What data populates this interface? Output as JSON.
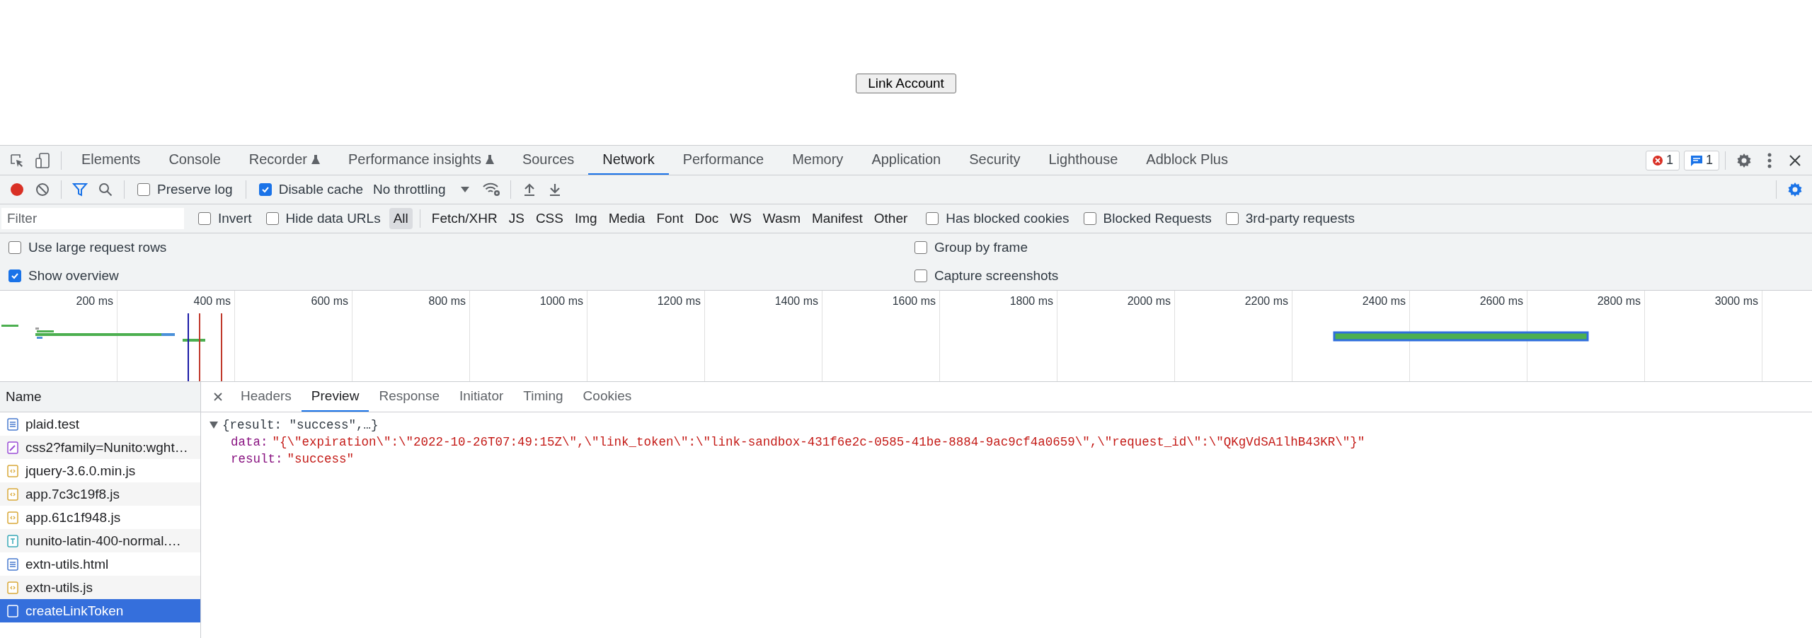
{
  "page": {
    "button": "Link Account"
  },
  "tabs": [
    {
      "label": "Elements",
      "selected": false,
      "experimental": false
    },
    {
      "label": "Console",
      "selected": false,
      "experimental": false
    },
    {
      "label": "Recorder",
      "selected": false,
      "experimental": true
    },
    {
      "label": "Performance insights",
      "selected": false,
      "experimental": true
    },
    {
      "label": "Sources",
      "selected": false,
      "experimental": false
    },
    {
      "label": "Network",
      "selected": true,
      "experimental": false
    },
    {
      "label": "Performance",
      "selected": false,
      "experimental": false
    },
    {
      "label": "Memory",
      "selected": false,
      "experimental": false
    },
    {
      "label": "Application",
      "selected": false,
      "experimental": false
    },
    {
      "label": "Security",
      "selected": false,
      "experimental": false
    },
    {
      "label": "Lighthouse",
      "selected": false,
      "experimental": false
    },
    {
      "label": "Adblock Plus",
      "selected": false,
      "experimental": false
    }
  ],
  "errors": "1",
  "messages": "1",
  "toolbar": {
    "recording": true,
    "filter_active": true,
    "checks": [
      {
        "label": "Preserve log",
        "checked": false
      },
      {
        "label": "Disable cache",
        "checked": true
      }
    ],
    "throttling": "No throttling"
  },
  "filter": {
    "placeholder": "Filter",
    "checks": [
      {
        "label": "Invert",
        "checked": false
      },
      {
        "label": "Hide data URLs",
        "checked": false
      }
    ],
    "types": [
      {
        "label": "All",
        "selected": true
      },
      {
        "label": "Fetch/XHR",
        "selected": false
      },
      {
        "label": "JS",
        "selected": false
      },
      {
        "label": "CSS",
        "selected": false
      },
      {
        "label": "Img",
        "selected": false
      },
      {
        "label": "Media",
        "selected": false
      },
      {
        "label": "Font",
        "selected": false
      },
      {
        "label": "Doc",
        "selected": false
      },
      {
        "label": "WS",
        "selected": false
      },
      {
        "label": "Wasm",
        "selected": false
      },
      {
        "label": "Manifest",
        "selected": false
      },
      {
        "label": "Other",
        "selected": false
      }
    ],
    "extra_checks": [
      {
        "label": "Has blocked cookies",
        "checked": false
      },
      {
        "label": "Blocked Requests",
        "checked": false
      },
      {
        "label": "3rd-party requests",
        "checked": false
      }
    ]
  },
  "options": [
    {
      "label": "Use large request rows",
      "checked": false
    },
    {
      "label": "Group by frame",
      "checked": false
    },
    {
      "label": "Show overview",
      "checked": true
    },
    {
      "label": "Capture screenshots",
      "checked": false
    }
  ],
  "overview": {
    "ticks": [
      "200 ms",
      "400 ms",
      "600 ms",
      "800 ms",
      "1000 ms",
      "1200 ms",
      "1400 ms",
      "1600 ms",
      "1800 ms",
      "2000 ms",
      "2200 ms",
      "2400 ms",
      "2600 ms",
      "2800 ms",
      "3000 ms"
    ]
  },
  "requests": {
    "header": "Name",
    "rows": [
      {
        "name": "plaid.test",
        "kind": "document",
        "selected": false
      },
      {
        "name": "css2?family=Nunito:wght…",
        "kind": "stylesheet",
        "selected": false
      },
      {
        "name": "jquery-3.6.0.min.js",
        "kind": "script",
        "selected": false
      },
      {
        "name": "app.7c3c19f8.js",
        "kind": "script",
        "selected": false
      },
      {
        "name": "app.61c1f948.js",
        "kind": "script",
        "selected": false
      },
      {
        "name": "nunito-latin-400-normal.…",
        "kind": "font",
        "selected": false
      },
      {
        "name": "extn-utils.html",
        "kind": "document",
        "selected": false
      },
      {
        "name": "extn-utils.js",
        "kind": "script",
        "selected": false
      },
      {
        "name": "createLinkToken",
        "kind": "fetch",
        "selected": true
      }
    ]
  },
  "detail": {
    "tabs": [
      {
        "label": "Headers",
        "selected": false
      },
      {
        "label": "Preview",
        "selected": true
      },
      {
        "label": "Response",
        "selected": false
      },
      {
        "label": "Initiator",
        "selected": false
      },
      {
        "label": "Timing",
        "selected": false
      },
      {
        "label": "Cookies",
        "selected": false
      }
    ],
    "preview": {
      "summary": "{result: \"success\",…}",
      "expanded": true,
      "entries": [
        {
          "key": "data:",
          "value": "\"{\\\"expiration\\\":\\\"2022-10-26T07:49:15Z\\\",\\\"link_token\\\":\\\"link-sandbox-431f6e2c-0585-41be-8884-9ac9cf4a0659\\\",\\\"request_id\\\":\\\"QKgVdSA1lhB43KR\\\"}\""
        },
        {
          "key": "result:",
          "value": "\"success\""
        }
      ]
    }
  }
}
